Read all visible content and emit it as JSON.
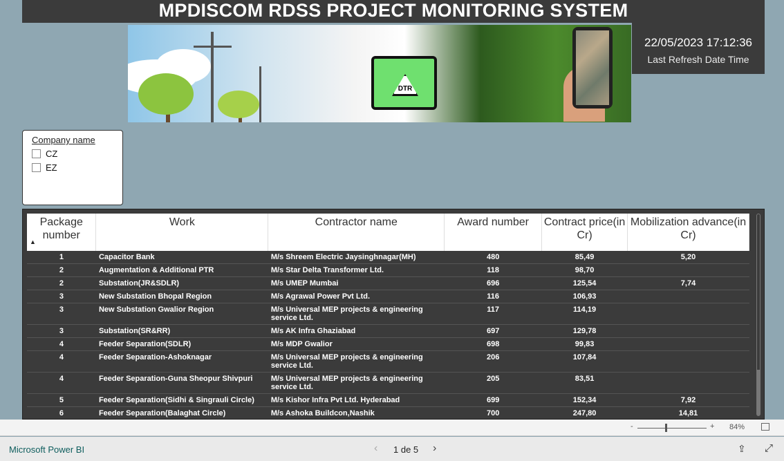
{
  "header": {
    "title": "MPDISCOM RDSS PROJECT MONITORING SYSTEM",
    "dtr_label": "DTR"
  },
  "refresh": {
    "datetime": "22/05/2023 17:12:36",
    "label": "Last Refresh Date Time"
  },
  "slicer": {
    "title": "Company name",
    "options": [
      "CZ",
      "EZ"
    ]
  },
  "table": {
    "columns": [
      "Package number",
      "Work",
      "Contractor name",
      "Award number",
      "Contract price(in Cr)",
      "Mobilization advance(in Cr)"
    ],
    "sort": "ascending",
    "rows": [
      [
        "1",
        "Capacitor Bank",
        "M/s Shreem Electric Jaysinghnagar(MH)",
        "480",
        "85,49",
        "5,20"
      ],
      [
        "2",
        "Augmentation & Additional PTR",
        "M/s Star Delta Transformer Ltd.",
        "118",
        "98,70",
        ""
      ],
      [
        "2",
        "Substation(JR&SDLR)",
        "M/s UMEP Mumbai",
        "696",
        "125,54",
        "7,74"
      ],
      [
        "3",
        "New Substation Bhopal Region",
        "M/s Agrawal Power Pvt Ltd.",
        "116",
        "106,93",
        ""
      ],
      [
        "3",
        "New Substation Gwalior Region",
        "M/s Universal MEP projects & engineering service Ltd.",
        "117",
        "114,19",
        ""
      ],
      [
        "3",
        "Substation(SR&RR)",
        "M/s AK Infra Ghaziabad",
        "697",
        "129,78",
        ""
      ],
      [
        "4",
        "Feeder Separation(SDLR)",
        "M/s MDP Gwalior",
        "698",
        "99,83",
        ""
      ],
      [
        "4",
        "Feeder Separation-Ashoknagar",
        "M/s Universal MEP projects & engineering service Ltd.",
        "206",
        "107,84",
        ""
      ],
      [
        "4",
        "Feeder Separation-Guna Sheopur Shivpuri",
        "M/s Universal MEP projects & engineering service Ltd.",
        "205",
        "83,51",
        ""
      ],
      [
        "5",
        "Feeder Separation(Sidhi & Singrauli Circle)",
        "M/s Kishor Infra Pvt Ltd. Hyderabad",
        "699",
        "152,34",
        "7,92"
      ],
      [
        "6",
        "Feeder Separation(Balaghat Circle)",
        "M/s Ashoka Buildcon,Nashik",
        "700",
        "247,80",
        "14,81"
      ]
    ]
  },
  "zoom": {
    "minus": "-",
    "plus": "+",
    "level": "84%",
    "value_percent": 84
  },
  "footer": {
    "brand": "Microsoft Power BI",
    "page": "1 de 5",
    "prev": "‹",
    "next": "›"
  }
}
